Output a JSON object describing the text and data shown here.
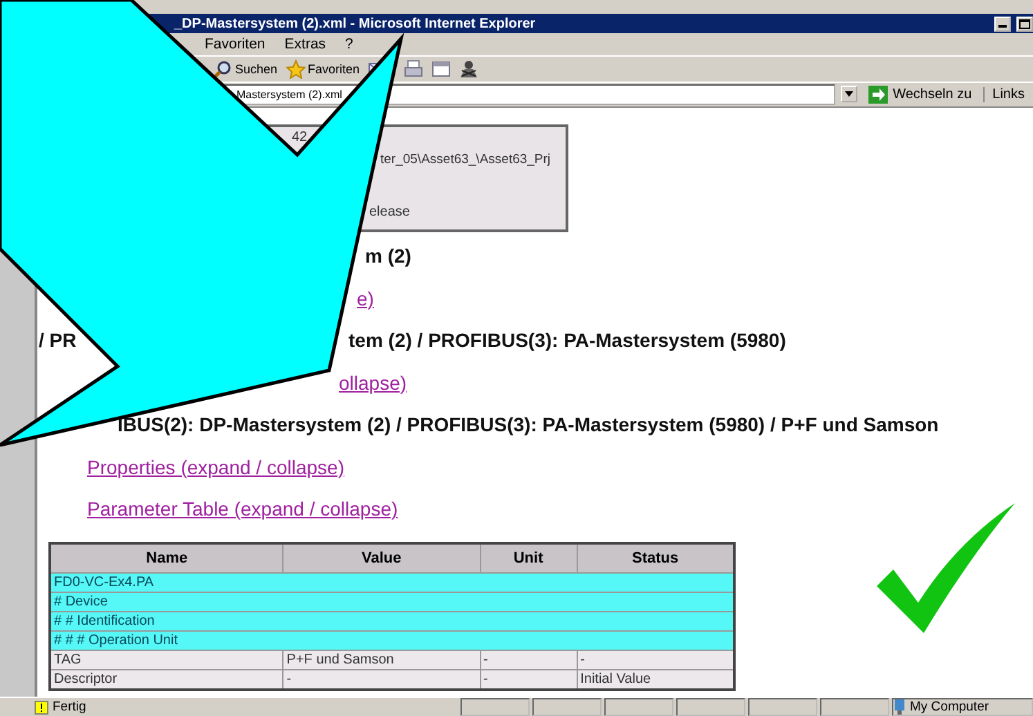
{
  "window": {
    "title": "_DP-Mastersystem (2).xml - Microsoft Internet Explorer"
  },
  "menu": [
    "Favoriten",
    "Extras",
    "?"
  ],
  "toolbar": [
    {
      "kind": "search",
      "label": "Suchen"
    },
    {
      "kind": "favorites",
      "label": "Favoriten"
    },
    {
      "kind": "mail"
    },
    {
      "kind": "print"
    },
    {
      "kind": "edit"
    },
    {
      "kind": "messenger"
    }
  ],
  "address": {
    "value": "Mastersystem (2).xml",
    "go": "Wechseln zu",
    "links": "Links"
  },
  "info_box": {
    "lines": [
      "42",
      "ter_05\\Asset63_\\Asset63_Prj",
      "elease"
    ]
  },
  "sections": [
    {
      "kind": "heading",
      "parts": [
        "m (2)"
      ]
    },
    {
      "kind": "link",
      "parts": [
        "e)"
      ]
    },
    {
      "kind": "heading",
      "parts": [
        "/ PR",
        "tem (2) / PROFIBUS(3): PA-Mastersystem (5980)"
      ]
    },
    {
      "kind": "link",
      "parts": [
        "ollapse)"
      ]
    },
    {
      "kind": "heading",
      "parts": [
        "IBUS(2): DP-Mastersystem (2) / PROFIBUS(3): PA-Mastersystem (5980) / P+F und Samson"
      ]
    },
    {
      "kind": "link",
      "parts": [
        "Properties (expand / collapse)"
      ]
    },
    {
      "kind": "link",
      "parts": [
        "Parameter Table (expand / collapse)"
      ]
    }
  ],
  "table": {
    "columns": [
      "Name",
      "Value",
      "Unit",
      "Status"
    ],
    "rows": [
      {
        "kind": "group",
        "cells": [
          "FD0-VC-Ex4.PA"
        ]
      },
      {
        "kind": "group",
        "cells": [
          "# Device"
        ]
      },
      {
        "kind": "group",
        "cells": [
          "# # Identification"
        ]
      },
      {
        "kind": "group",
        "cells": [
          "# # # Operation Unit"
        ]
      },
      {
        "kind": "param",
        "cells": [
          "TAG",
          "P+F und Samson",
          "-",
          "-"
        ]
      },
      {
        "kind": "param",
        "cells": [
          "Descriptor",
          "-",
          "-",
          "Initial Value"
        ]
      }
    ]
  },
  "status_bar": {
    "text": "Fertig",
    "zone": "My Computer"
  }
}
